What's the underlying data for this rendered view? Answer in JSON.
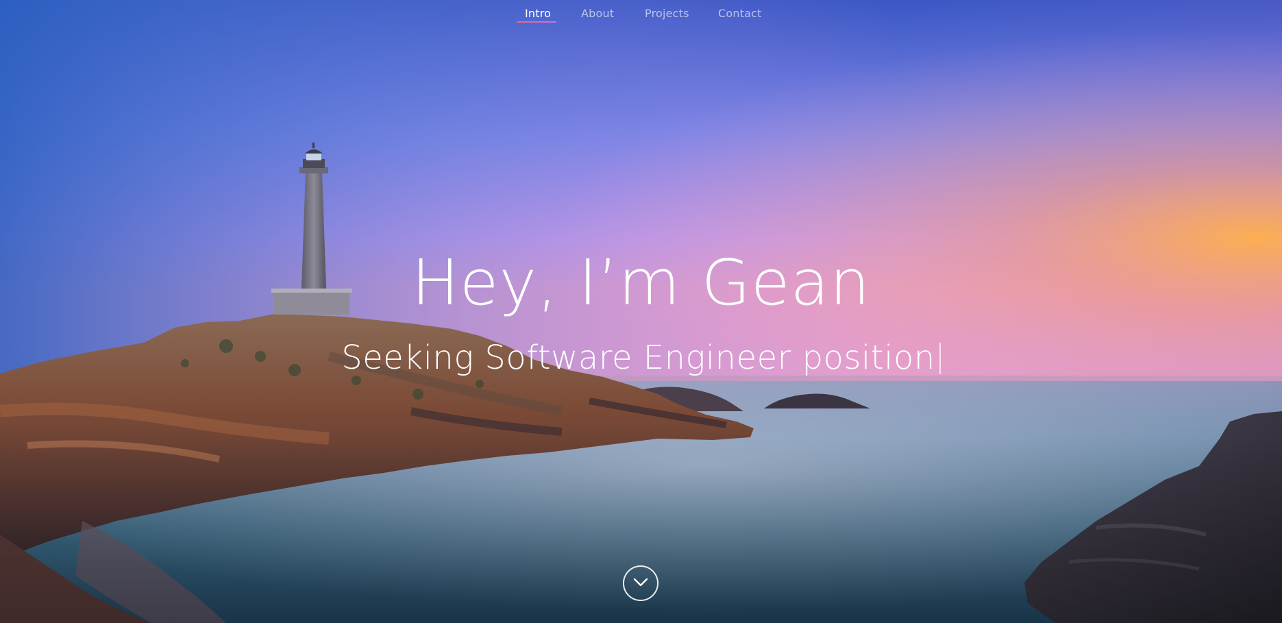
{
  "nav": {
    "items": [
      {
        "label": "Intro",
        "active": true
      },
      {
        "label": "About",
        "active": false
      },
      {
        "label": "Projects",
        "active": false
      },
      {
        "label": "Contact",
        "active": false
      }
    ],
    "underline_colors": [
      "#ff5f6d",
      "#c471ed"
    ]
  },
  "hero": {
    "headline": "Hey, I’m Gean",
    "subline": "Seeking Software Engineer position",
    "scroll_icon": "chevron-down-icon",
    "colors": {
      "sky_top": "#3a5cc8",
      "sky_mid": "#a98bea",
      "sunset_glow": "#f4a25a",
      "water": "#2f5f78"
    }
  }
}
